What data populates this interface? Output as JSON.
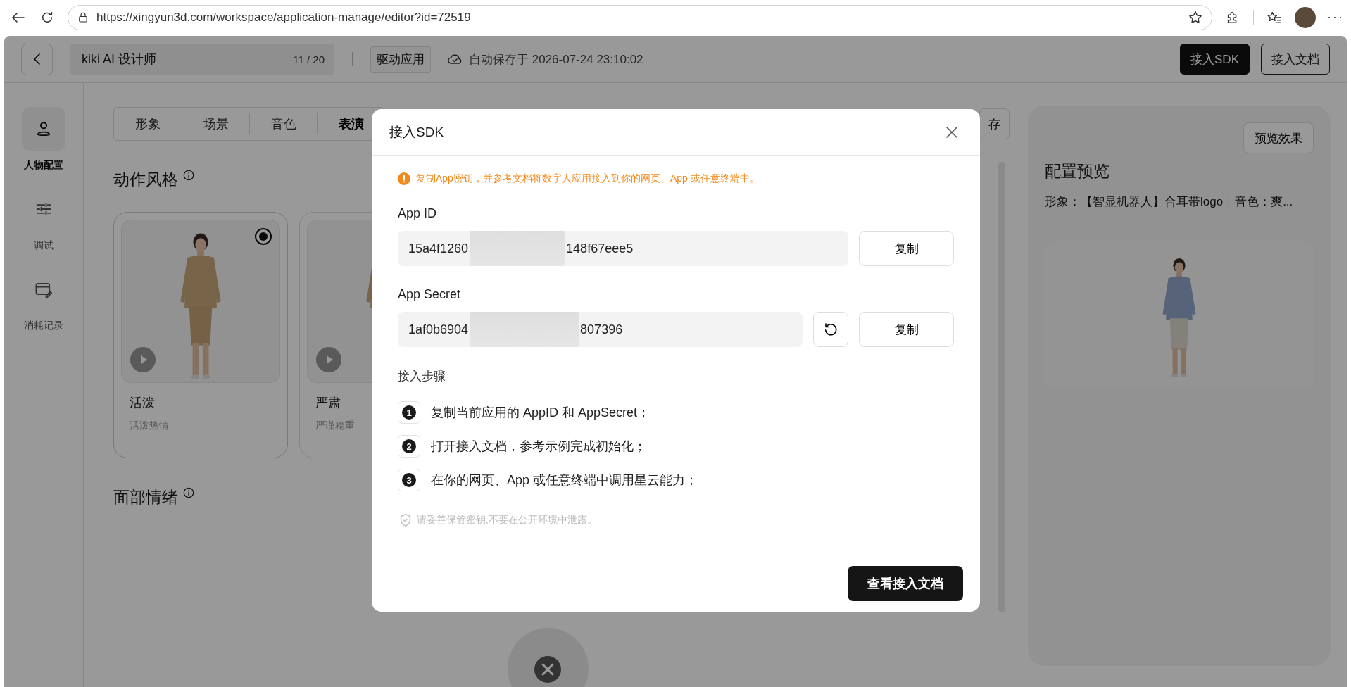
{
  "browser": {
    "url": "https://xingyun3d.com/workspace/application-manage/editor?id=72519"
  },
  "header": {
    "name": "kiki AI 设计师",
    "count": "11 / 20",
    "tag": "驱动应用",
    "autosave": "自动保存于 2026-07-24 23:10:02",
    "buttons": [
      {
        "label": "接入SDK",
        "kind": "primary"
      },
      {
        "label": "接入文档",
        "kind": "outline"
      }
    ]
  },
  "sidebar": {
    "items": [
      {
        "label": "人物配置",
        "selected": true
      },
      {
        "label": "调试",
        "selected": false
      },
      {
        "label": "消耗记录",
        "selected": false
      }
    ]
  },
  "tabs": [
    {
      "label": "形象",
      "selected": false
    },
    {
      "label": "场景",
      "selected": false
    },
    {
      "label": "音色",
      "selected": false
    },
    {
      "label": "表演",
      "selected": true
    }
  ],
  "save_button": "存",
  "sections": [
    {
      "title": "动作风格",
      "cards": [
        {
          "title": "活泼",
          "subtitle": "活泼热情",
          "selected": true
        },
        {
          "title": "严肃",
          "subtitle": "严谨稳重",
          "selected": false
        }
      ]
    },
    {
      "title": "面部情绪"
    }
  ],
  "preview": {
    "button": "预览效果",
    "title": "配置预览",
    "summary": "形象：【智显机器人】合耳带logo｜音色：爽..."
  },
  "dialog": {
    "title": "接入SDK",
    "notice": "复制App密钥，并参考文档将数字人应用接入到你的网页、App 或任意终端中。",
    "fields": [
      {
        "label": "App ID",
        "value_start": "15a4f1260",
        "value_end": "148f67eee5",
        "resettable": false,
        "copy": "复制"
      },
      {
        "label": "App Secret",
        "value_start": "1af0b6904",
        "value_end": "807396",
        "resettable": true,
        "copy": "复制"
      }
    ],
    "steps_title": "接入步骤",
    "steps": [
      {
        "number": "1",
        "text": "复制当前应用的 AppID 和 AppSecret；"
      },
      {
        "number": "2",
        "text": "打开接入文档，参考示例完成初始化；"
      },
      {
        "number": "3",
        "text": "在你的网页、App 或任意终端中调用星云能力；"
      }
    ],
    "tip": "请妥善保管密钥,不要在公开环境中泄露。",
    "action": "查看接入文档"
  }
}
